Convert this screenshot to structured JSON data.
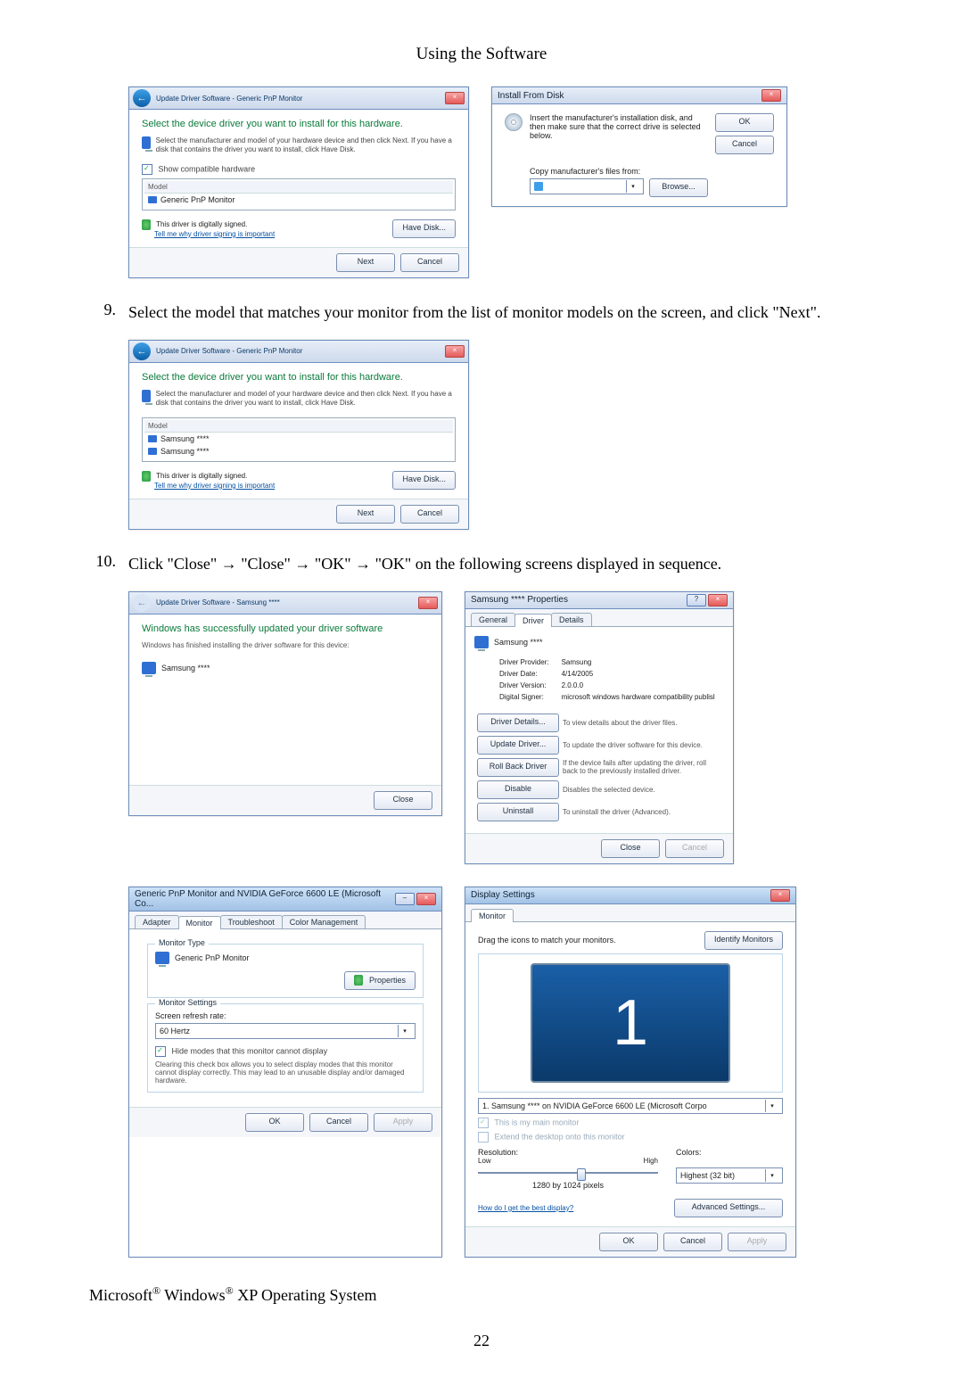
{
  "page": {
    "header": "Using the Software",
    "number": "22"
  },
  "steps": {
    "s9_num": "9.",
    "s9_text": "Select the model that matches your monitor from the list of monitor models on the screen, and click \"Next\".",
    "s10_num": "10.",
    "s10_text": "Click \"Close\" → \"Close\" → \"OK\" → \"OK\" on the following screens displayed in sequence."
  },
  "os_heading": {
    "prefix": "Microsoft",
    "middle": " Windows",
    "suffix": " XP Operating System"
  },
  "dlg_update1": {
    "title": "Update Driver Software - Generic PnP Monitor",
    "heading": "Select the device driver you want to install for this hardware.",
    "subtext": "Select the manufacturer and model of your hardware device and then click Next. If you have a disk that contains the driver you want to install, click Have Disk.",
    "show_compat": "Show compatible hardware",
    "col_model": "Model",
    "item1": "Generic PnP Monitor",
    "signed": "This driver is digitally signed.",
    "tell_why": "Tell me why driver signing is important",
    "have_disk": "Have Disk...",
    "next": "Next",
    "cancel": "Cancel"
  },
  "dlg_install_from_disk": {
    "title": "Install From Disk",
    "msg": "Insert the manufacturer's installation disk, and then make sure that the correct drive is selected below.",
    "ok": "OK",
    "cancel": "Cancel",
    "copy_from": "Copy manufacturer's files from:",
    "browse": "Browse..."
  },
  "dlg_update2": {
    "title": "Update Driver Software - Generic PnP Monitor",
    "heading": "Select the device driver you want to install for this hardware.",
    "subtext": "Select the manufacturer and model of your hardware device and then click Next. If you have a disk that contains the driver you want to install, click Have Disk.",
    "col_model": "Model",
    "item1": "Samsung ****",
    "item2": "Samsung ****",
    "signed": "This driver is digitally signed.",
    "tell_why": "Tell me why driver signing is important",
    "have_disk": "Have Disk...",
    "next": "Next",
    "cancel": "Cancel"
  },
  "dlg_update_success": {
    "title": "Update Driver Software - Samsung ****",
    "heading": "Windows has successfully updated your driver software",
    "subtext": "Windows has finished installing the driver software for this device:",
    "device": "Samsung ****",
    "close": "Close"
  },
  "dlg_samsung_props": {
    "title": "Samsung **** Properties",
    "tab_general": "General",
    "tab_driver": "Driver",
    "tab_details": "Details",
    "device": "Samsung ****",
    "provider_l": "Driver Provider:",
    "provider_v": "Samsung",
    "date_l": "Driver Date:",
    "date_v": "4/14/2005",
    "version_l": "Driver Version:",
    "version_v": "2.0.0.0",
    "signer_l": "Digital Signer:",
    "signer_v": "microsoft windows hardware compatibility publisl",
    "btn_details": "Driver Details...",
    "btn_details_help": "To view details about the driver files.",
    "btn_update": "Update Driver...",
    "btn_update_help": "To update the driver software for this device.",
    "btn_rollback": "Roll Back Driver",
    "btn_rollback_help": "If the device fails after updating the driver, roll back to the previously installed driver.",
    "btn_disable": "Disable",
    "btn_disable_help": "Disables the selected device.",
    "btn_uninstall": "Uninstall",
    "btn_uninstall_help": "To uninstall the driver (Advanced).",
    "close": "Close",
    "cancel": "Cancel"
  },
  "dlg_generic_monitor": {
    "title": "Generic PnP Monitor and NVIDIA GeForce 6600 LE (Microsoft Co...",
    "tab_adapter": "Adapter",
    "tab_monitor": "Monitor",
    "tab_troubleshoot": "Troubleshoot",
    "tab_colormgmt": "Color Management",
    "grp_type": "Monitor Type",
    "type_v": "Generic PnP Monitor",
    "btn_props": "Properties",
    "grp_settings": "Monitor Settings",
    "refresh_l": "Screen refresh rate:",
    "refresh_v": "60 Hertz",
    "hide_modes": "Hide modes that this monitor cannot display",
    "hide_help": "Clearing this check box allows you to select display modes that this monitor cannot display correctly. This may lead to an unusable display and/or damaged hardware.",
    "ok": "OK",
    "cancel": "Cancel",
    "apply": "Apply"
  },
  "dlg_display_settings": {
    "title": "Display Settings",
    "tab_monitor": "Monitor",
    "drag": "Drag the icons to match your monitors.",
    "identify": "Identify Monitors",
    "big": "1",
    "sel_monitor": "1. Samsung **** on NVIDIA GeForce 6600 LE (Microsoft Corpo",
    "this_main": "This is my main monitor",
    "extend": "Extend the desktop onto this monitor",
    "res_l": "Resolution:",
    "low": "Low",
    "high": "High",
    "res_v": "1280 by 1024 pixels",
    "colors_l": "Colors:",
    "colors_v": "Highest (32 bit)",
    "best_link": "How do I get the best display?",
    "adv": "Advanced Settings...",
    "ok": "OK",
    "cancel": "Cancel",
    "apply": "Apply"
  }
}
